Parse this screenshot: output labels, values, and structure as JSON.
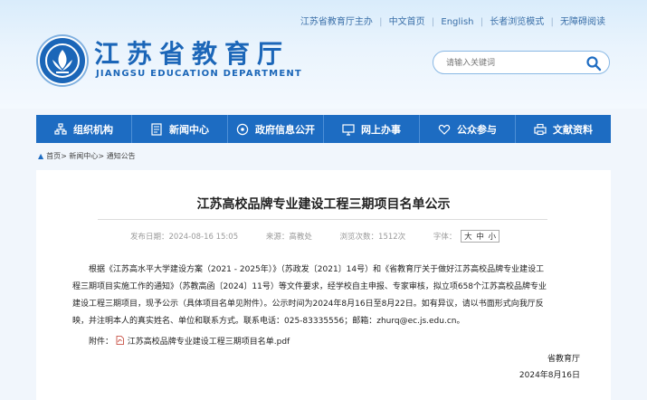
{
  "top_links": [
    "江苏省教育厅主办",
    "中文首页",
    "English",
    "长者浏览模式",
    "无障碍阅读"
  ],
  "site": {
    "title": "江苏省教育厅",
    "subtitle": "JIANGSU EDUCATION DEPARTMENT"
  },
  "search": {
    "placeholder": "请输入关键词",
    "icon": "search-icon"
  },
  "nav": [
    {
      "label": "组织机构",
      "icon": "org-chart-icon"
    },
    {
      "label": "新闻中心",
      "icon": "news-icon"
    },
    {
      "label": "政府信息公开",
      "icon": "info-disclosure-icon"
    },
    {
      "label": "网上办事",
      "icon": "monitor-icon"
    },
    {
      "label": "公众参与",
      "icon": "heart-icon"
    },
    {
      "label": "文献资料",
      "icon": "printer-icon"
    }
  ],
  "breadcrumb": "首页> 新闻中心> 通知公告",
  "article": {
    "title": "江苏高校品牌专业建设工程三期项目名单公示",
    "publish_date": "发布日期：2024-08-16 15:05",
    "source": "来源：高教处",
    "views": "浏览次数：1512次",
    "font_label": "字体：",
    "font_sizes": [
      "大",
      "中",
      "小"
    ],
    "lines": [
      "根据《江苏高水平大学建设方案（2021 - 2025年）》（苏政发〔2021〕14号）和《省教育厅关于做好江苏高校品牌专业建设工",
      "程三期项目实施工作的通知》（苏教高函〔2024〕11号）等文件要求，经学校自主申报、专家审核，拟立项658个江苏高校品牌专业",
      "建设工程三期项目，现予公示（具体项目名单见附件）。公示时间为2024年8月16日至8月22日。如有异议，请以书面形式向我厅反",
      "映，并注明本人的真实姓名、单位和联系方式。联系电话：025-83335556；邮箱：zhurq@ec.js.edu.cn。"
    ],
    "attachment_label": "附件：",
    "attachment_name": "江苏高校品牌专业建设工程三期项目名单.pdf",
    "signature": "省教育厅",
    "date": "2024年8月16日"
  },
  "colors": {
    "nav_bg": "#1d6cc2",
    "brand": "#1b66b8"
  }
}
